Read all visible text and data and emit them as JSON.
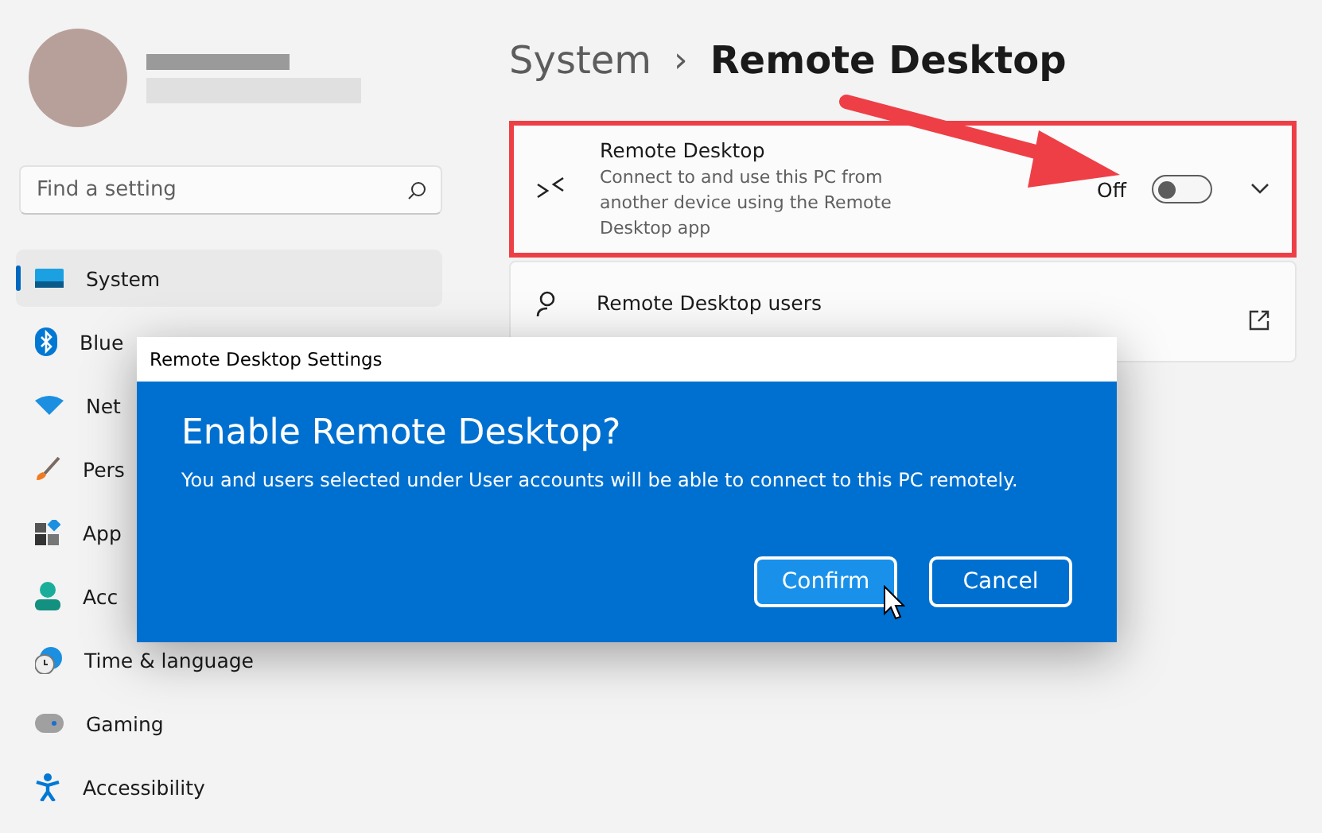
{
  "sidebar": {
    "search": {
      "placeholder": "Find a setting"
    },
    "items": [
      {
        "label": "System",
        "selected": true
      },
      {
        "label": "Blue",
        "selected": false
      },
      {
        "label": "Net",
        "selected": false
      },
      {
        "label": "Pers",
        "selected": false
      },
      {
        "label": "App",
        "selected": false
      },
      {
        "label": "Acc",
        "selected": false
      },
      {
        "label": "Time & language",
        "selected": false
      },
      {
        "label": "Gaming",
        "selected": false
      },
      {
        "label": "Accessibility",
        "selected": false
      }
    ]
  },
  "breadcrumb": {
    "parent": "System",
    "separator": "›",
    "current": "Remote Desktop"
  },
  "settings": [
    {
      "kind": "toggle",
      "title": "Remote Desktop",
      "description": "Connect to and use this PC from another device using the Remote Desktop app",
      "state_label": "Off",
      "on": false,
      "highlighted": true
    },
    {
      "kind": "link",
      "title": "Remote Desktop users",
      "highlighted": false
    }
  ],
  "dialog": {
    "title": "Remote Desktop Settings",
    "heading": "Enable Remote Desktop?",
    "message": "You and users selected under User accounts will be able to connect to this PC remotely.",
    "buttons": [
      {
        "label": "Confirm",
        "hovered": true
      },
      {
        "label": "Cancel",
        "hovered": false
      }
    ]
  }
}
